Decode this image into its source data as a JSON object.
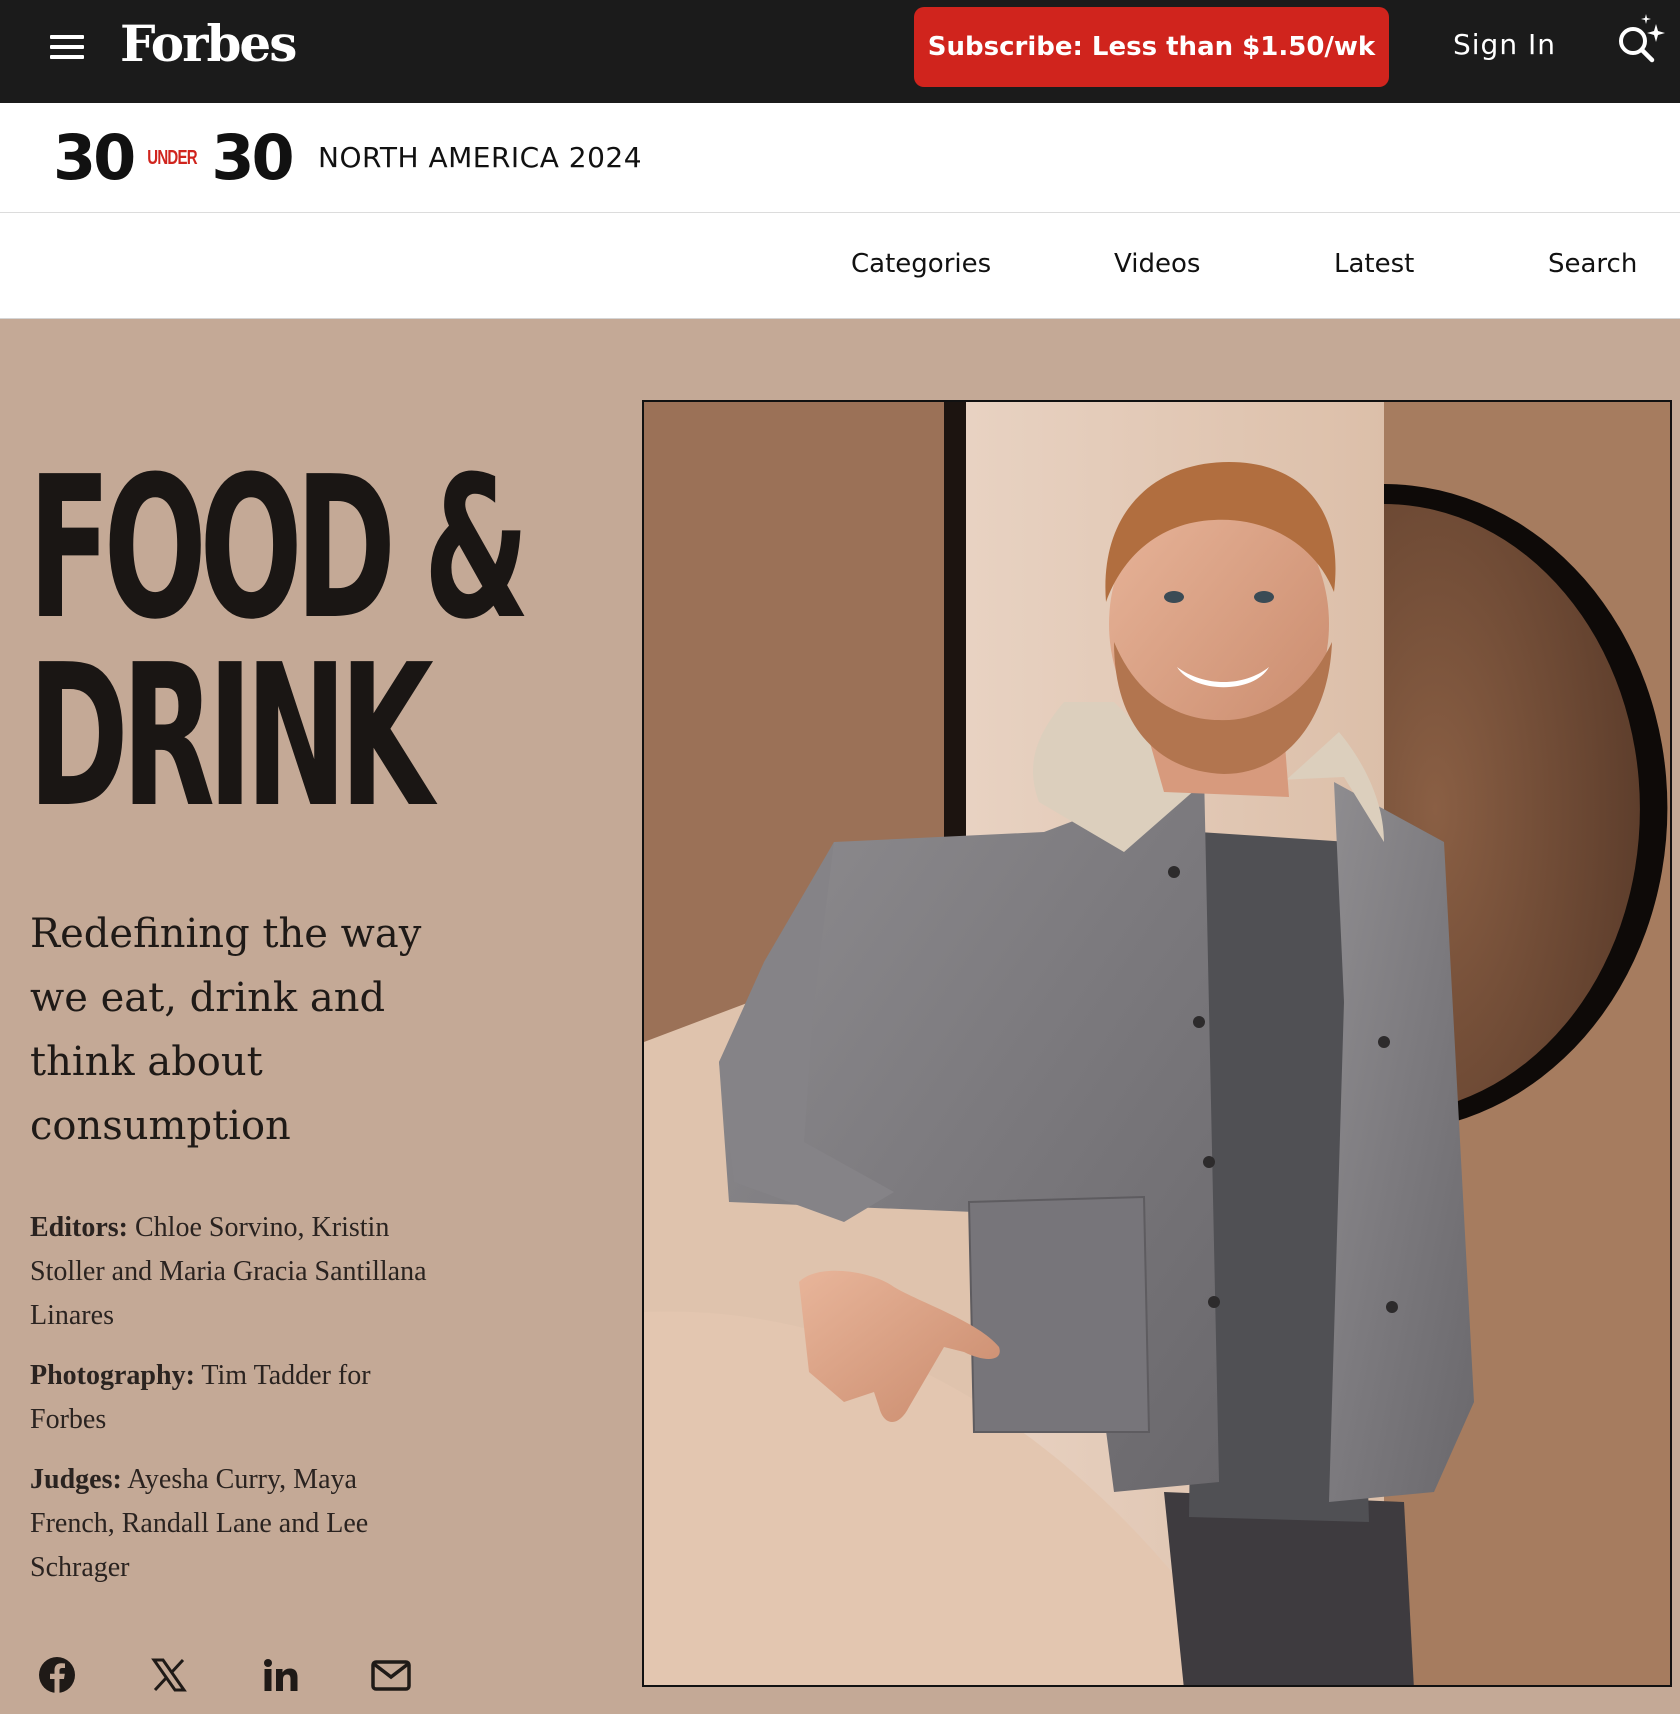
{
  "header": {
    "logo": "Forbes",
    "subscribe_label": "Subscribe: Less than $1.50/wk",
    "signin_label": "Sign In"
  },
  "brand": {
    "num_left": "30",
    "under": "UNDER",
    "num_right": "30",
    "edition": "NORTH AMERICA 2024"
  },
  "nav": {
    "items": [
      "Categories",
      "Videos",
      "Latest",
      "Search"
    ]
  },
  "hero": {
    "title_line1": "FOOD &",
    "title_line2": "DRINK",
    "tagline": "Redefining the way we eat, drink and think about consumption",
    "editors_label": "Editors:",
    "editors_value": "Chloe Sorvino, Kristin Stoller and Maria Gracia Santillana Linares",
    "photography_label": "Photography:",
    "photography_value": "Tim Tadder for Forbes",
    "judges_label": "Judges:",
    "judges_value": "Ayesha Curry, Maya French, Randall Lane and Lee Schrager"
  },
  "share_icons": [
    "facebook-icon",
    "x-icon",
    "linkedin-icon",
    "mail-icon"
  ],
  "colors": {
    "topbar": "#1b1b1b",
    "subscribe": "#d0241d",
    "page_bg": "#c4a996",
    "title_text": "#1a1614"
  }
}
